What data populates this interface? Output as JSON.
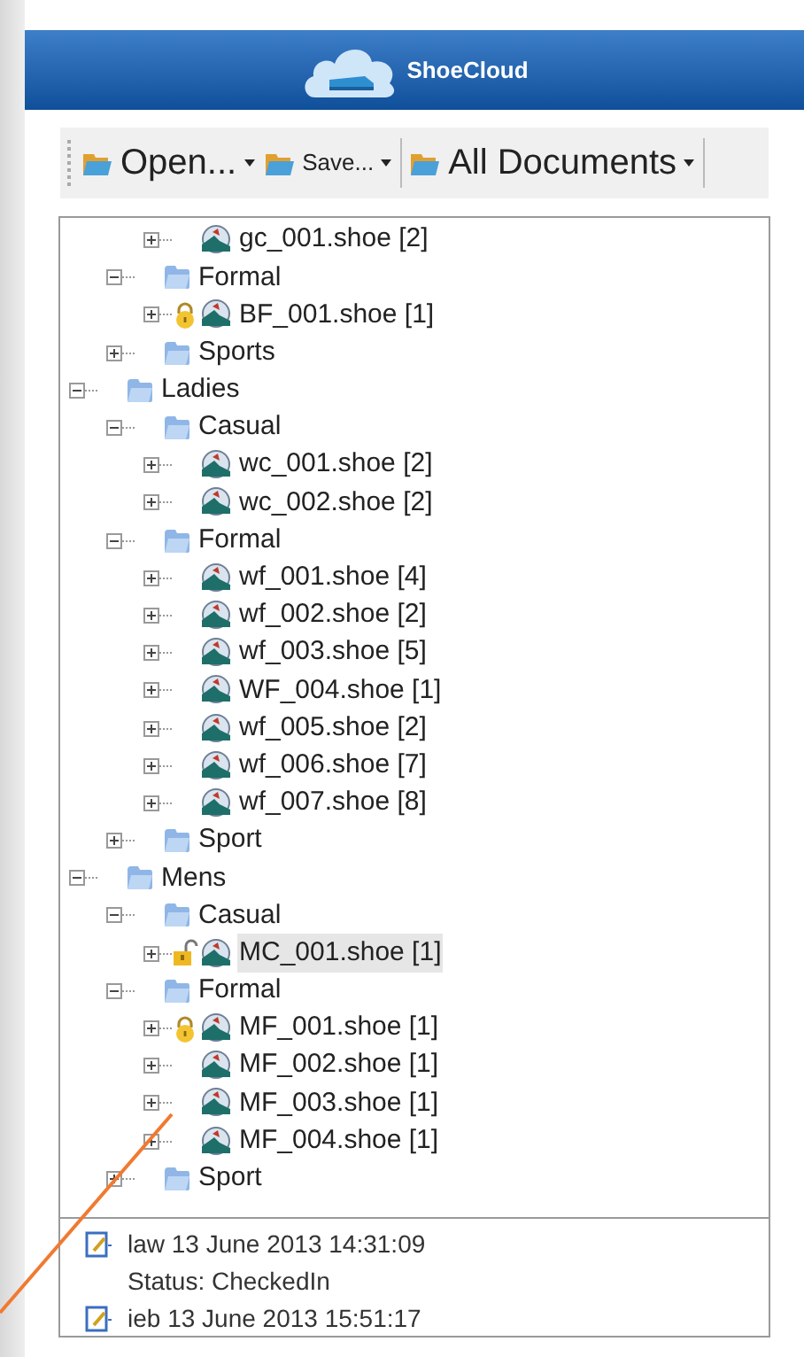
{
  "app": {
    "title": "ShoeCloud"
  },
  "toolbar": [
    {
      "kind": "large",
      "label": "Open..."
    },
    {
      "kind": "small",
      "label": "Save..."
    },
    {
      "kind": "large",
      "label": "All Documents"
    }
  ],
  "tree": [
    {
      "children": [
        {
          "children": [
            {
              "kind": "file",
              "label": "gc_001.shoe [2]",
              "expanded": false,
              "selected": false,
              "locked": false,
              "unlocked": false
            }
          ]
        },
        {
          "kind": "folder",
          "label": "Formal",
          "expanded": true,
          "selected": false,
          "children": [
            {
              "kind": "file",
              "label": "BF_001.shoe [1]",
              "expanded": false,
              "selected": false,
              "locked": true,
              "unlocked": false
            }
          ]
        },
        {
          "kind": "folder",
          "label": "Sports",
          "expanded": false,
          "selected": false
        }
      ]
    },
    {
      "kind": "folder",
      "label": "Ladies",
      "expanded": true,
      "selected": false,
      "children": [
        {
          "kind": "folder",
          "label": "Casual",
          "expanded": true,
          "selected": false,
          "children": [
            {
              "kind": "file",
              "label": "wc_001.shoe [2]",
              "expanded": false,
              "selected": false,
              "locked": false,
              "unlocked": false
            },
            {
              "kind": "file",
              "label": "wc_002.shoe [2]",
              "expanded": false,
              "selected": false,
              "locked": false,
              "unlocked": false
            }
          ]
        },
        {
          "kind": "folder",
          "label": "Formal",
          "expanded": true,
          "selected": false,
          "children": [
            {
              "kind": "file",
              "label": "wf_001.shoe [4]",
              "expanded": false,
              "selected": false,
              "locked": false,
              "unlocked": false
            },
            {
              "kind": "file",
              "label": "wf_002.shoe [2]",
              "expanded": false,
              "selected": false,
              "locked": false,
              "unlocked": false
            },
            {
              "kind": "file",
              "label": "wf_003.shoe [5]",
              "expanded": false,
              "selected": false,
              "locked": false,
              "unlocked": false
            },
            {
              "kind": "file",
              "label": "WF_004.shoe [1]",
              "expanded": false,
              "selected": false,
              "locked": false,
              "unlocked": false
            },
            {
              "kind": "file",
              "label": "wf_005.shoe [2]",
              "expanded": false,
              "selected": false,
              "locked": false,
              "unlocked": false
            },
            {
              "kind": "file",
              "label": "wf_006.shoe [7]",
              "expanded": false,
              "selected": false,
              "locked": false,
              "unlocked": false
            },
            {
              "kind": "file",
              "label": "wf_007.shoe [8]",
              "expanded": false,
              "selected": false,
              "locked": false,
              "unlocked": false
            }
          ]
        },
        {
          "kind": "folder",
          "label": "Sport",
          "expanded": false,
          "selected": false
        }
      ]
    },
    {
      "kind": "folder",
      "label": "Mens",
      "expanded": true,
      "selected": false,
      "children": [
        {
          "kind": "folder",
          "label": "Casual",
          "expanded": true,
          "selected": false,
          "children": [
            {
              "kind": "file",
              "label": "MC_001.shoe [1]",
              "expanded": false,
              "selected": true,
              "locked": false,
              "unlocked": true
            }
          ]
        },
        {
          "kind": "folder",
          "label": "Formal",
          "expanded": true,
          "selected": false,
          "children": [
            {
              "kind": "file",
              "label": "MF_001.shoe [1]",
              "expanded": false,
              "selected": false,
              "locked": true,
              "unlocked": false
            },
            {
              "kind": "file",
              "label": "MF_002.shoe [1]",
              "expanded": false,
              "selected": false,
              "locked": false,
              "unlocked": false
            },
            {
              "kind": "file",
              "label": "MF_003.shoe [1]",
              "expanded": false,
              "selected": false,
              "locked": false,
              "unlocked": false
            },
            {
              "kind": "file",
              "label": "MF_004.shoe [1]",
              "expanded": false,
              "selected": false,
              "locked": false,
              "unlocked": false
            }
          ]
        },
        {
          "kind": "folder",
          "label": "Sport",
          "expanded": false,
          "selected": false
        }
      ]
    }
  ],
  "history": [
    {
      "kind": "entry",
      "text": "law 13 June 2013 14:31:09"
    },
    {
      "kind": "status",
      "text": "Status: CheckedIn"
    },
    {
      "kind": "entry",
      "text": "ieb 13 June 2013 15:51:17"
    }
  ]
}
